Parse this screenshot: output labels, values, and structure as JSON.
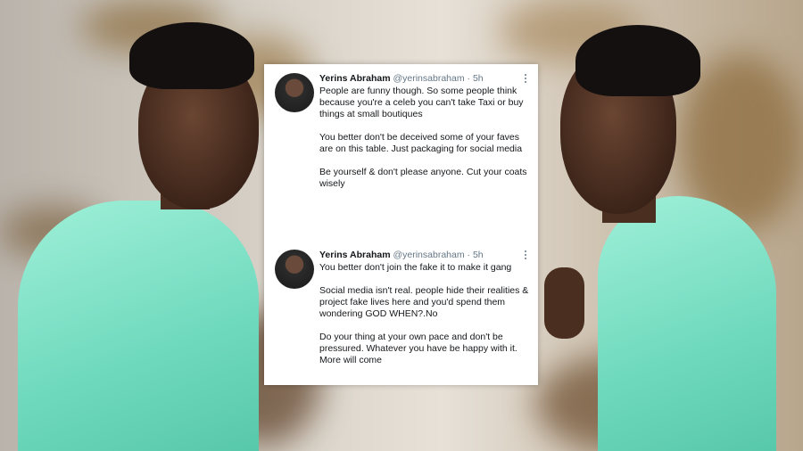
{
  "tweets": [
    {
      "author": "Yerins Abraham",
      "handle": "@yerinsabraham",
      "time": "5h",
      "paragraphs": [
        "People are funny though. So some people think because you're a celeb you can't take Taxi or buy things at small boutiques",
        "You better don't be deceived some of your faves are on this table. Just packaging for social media",
        "Be yourself & don't please anyone. Cut your coats wisely"
      ]
    },
    {
      "author": "Yerins Abraham",
      "handle": "@yerinsabraham",
      "time": "5h",
      "paragraphs": [
        "You better don't join the fake it to make it gang",
        "Social media isn't real. people hide their realities & project fake lives here and you'd spend them wondering GOD WHEN?.No",
        "Do your thing at your own pace and don't be pressured. Whatever you have be happy with it. More will come"
      ]
    }
  ],
  "colors": {
    "shirt": "#8ee8cf",
    "card": "#ffffff",
    "text": "#14171a",
    "meta": "#657786"
  }
}
